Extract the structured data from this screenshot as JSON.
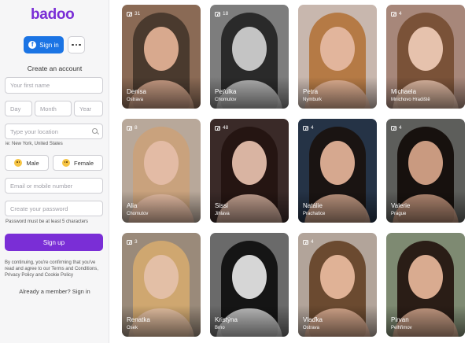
{
  "brand": {
    "logo_text": "badoo",
    "accent": "#7a2ed6"
  },
  "auth": {
    "sign_in_label": "Sign in",
    "create_title": "Create an account",
    "first_name_placeholder": "Your first name",
    "day_placeholder": "Day",
    "month_placeholder": "Month",
    "year_placeholder": "Year",
    "location_placeholder": "Type your location",
    "location_hint": "ie: New York, United States",
    "gender_male": "Male",
    "gender_female": "Female",
    "email_placeholder": "Email or mobile number",
    "password_placeholder": "Create your password",
    "password_hint": "Password must be at least 5 characters",
    "sign_up_label": "Sign up",
    "legal_prefix": "By continuing, you're confirming that you've read and agree to our ",
    "terms_label": "Terms and Conditions",
    "legal_comma": ", ",
    "privacy_label": "Privacy Policy",
    "legal_and": " and ",
    "cookie_label": "Cookie Policy",
    "already_member": "Already a member? Sign in"
  },
  "profiles": [
    {
      "name": "Denisa",
      "city": "Ostrava",
      "photos": "31",
      "bg": "#8a6a55",
      "skin": "#d8a98e",
      "hair": "#4a3a2e"
    },
    {
      "name": "Peťulka",
      "city": "Chomutov",
      "photos": "18",
      "bg": "#7d7d7d",
      "skin": "#c4c4c4",
      "hair": "#2a2a2a"
    },
    {
      "name": "Petra",
      "city": "Nymburk",
      "photos": "",
      "bg": "#c8b7ae",
      "skin": "#e2b59c",
      "hair": "#b57a45"
    },
    {
      "name": "Michaela",
      "city": "Mnichovo Hradiště",
      "photos": "4",
      "bg": "#a7877a",
      "skin": "#e6c2ad",
      "hair": "#7a5238"
    },
    {
      "name": "Alia",
      "city": "Chomutov",
      "photos": "8",
      "bg": "#b8a89a",
      "skin": "#e3bba5",
      "hair": "#c9a27d"
    },
    {
      "name": "Sissi",
      "city": "Jihlava",
      "photos": "48",
      "bg": "#3a2a28",
      "skin": "#d9b4a2",
      "hair": "#251512"
    },
    {
      "name": "Natálie",
      "city": "Prachatice",
      "photos": "4",
      "bg": "#253346",
      "skin": "#d6a88f",
      "hair": "#1a1412"
    },
    {
      "name": "Valerie",
      "city": "Prague",
      "photos": "4",
      "bg": "#5d5e5b",
      "skin": "#c99a80",
      "hair": "#17110e"
    },
    {
      "name": "Renatka",
      "city": "Osek",
      "photos": "3",
      "bg": "#9a8a7a",
      "skin": "#e3bfa6",
      "hair": "#cfa770"
    },
    {
      "name": "Kristýna",
      "city": "Brno",
      "photos": "",
      "bg": "#6a6a6a",
      "skin": "#d6d6d6",
      "hair": "#151515"
    },
    {
      "name": "Vlaďka",
      "city": "Ostrava",
      "photos": "4",
      "bg": "#b2a49a",
      "skin": "#e0b296",
      "hair": "#6b4a30"
    },
    {
      "name": "Pirvan",
      "city": "Pelhřimov",
      "photos": "",
      "bg": "#7e8a72",
      "skin": "#d9ab90",
      "hair": "#2a1d16"
    }
  ]
}
